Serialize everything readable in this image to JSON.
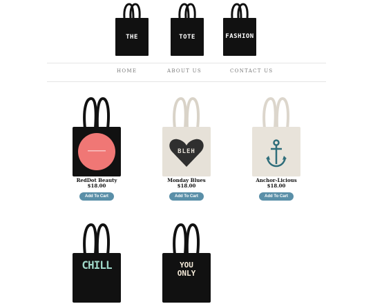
{
  "logo": {
    "words": [
      "THE",
      "TOTE",
      "FASHION"
    ]
  },
  "nav": {
    "items": [
      "HOME",
      "ABOUT US",
      "CONTACT US"
    ]
  },
  "products": [
    {
      "name": "RedDot Beauty",
      "price": "$18.00",
      "button": "Add To Cart",
      "bag_color": "#111111"
    },
    {
      "name": "Monday Blues",
      "price": "$18.00",
      "button": "Add To Cart",
      "bag_color": "#e6e1d8",
      "print_text": "BLEH"
    },
    {
      "name": "Anchor-Licious",
      "price": "$18.00",
      "button": "Add To Cart",
      "bag_color": "#e8e3da"
    },
    {
      "bag_color": "#111111",
      "print_text": "CHILL"
    },
    {
      "bag_color": "#111111",
      "print_text": "YOU ONLY"
    }
  ],
  "colors": {
    "button": "#5a8fa8",
    "divider": "#e4e4e4",
    "nav_text": "#777777"
  }
}
